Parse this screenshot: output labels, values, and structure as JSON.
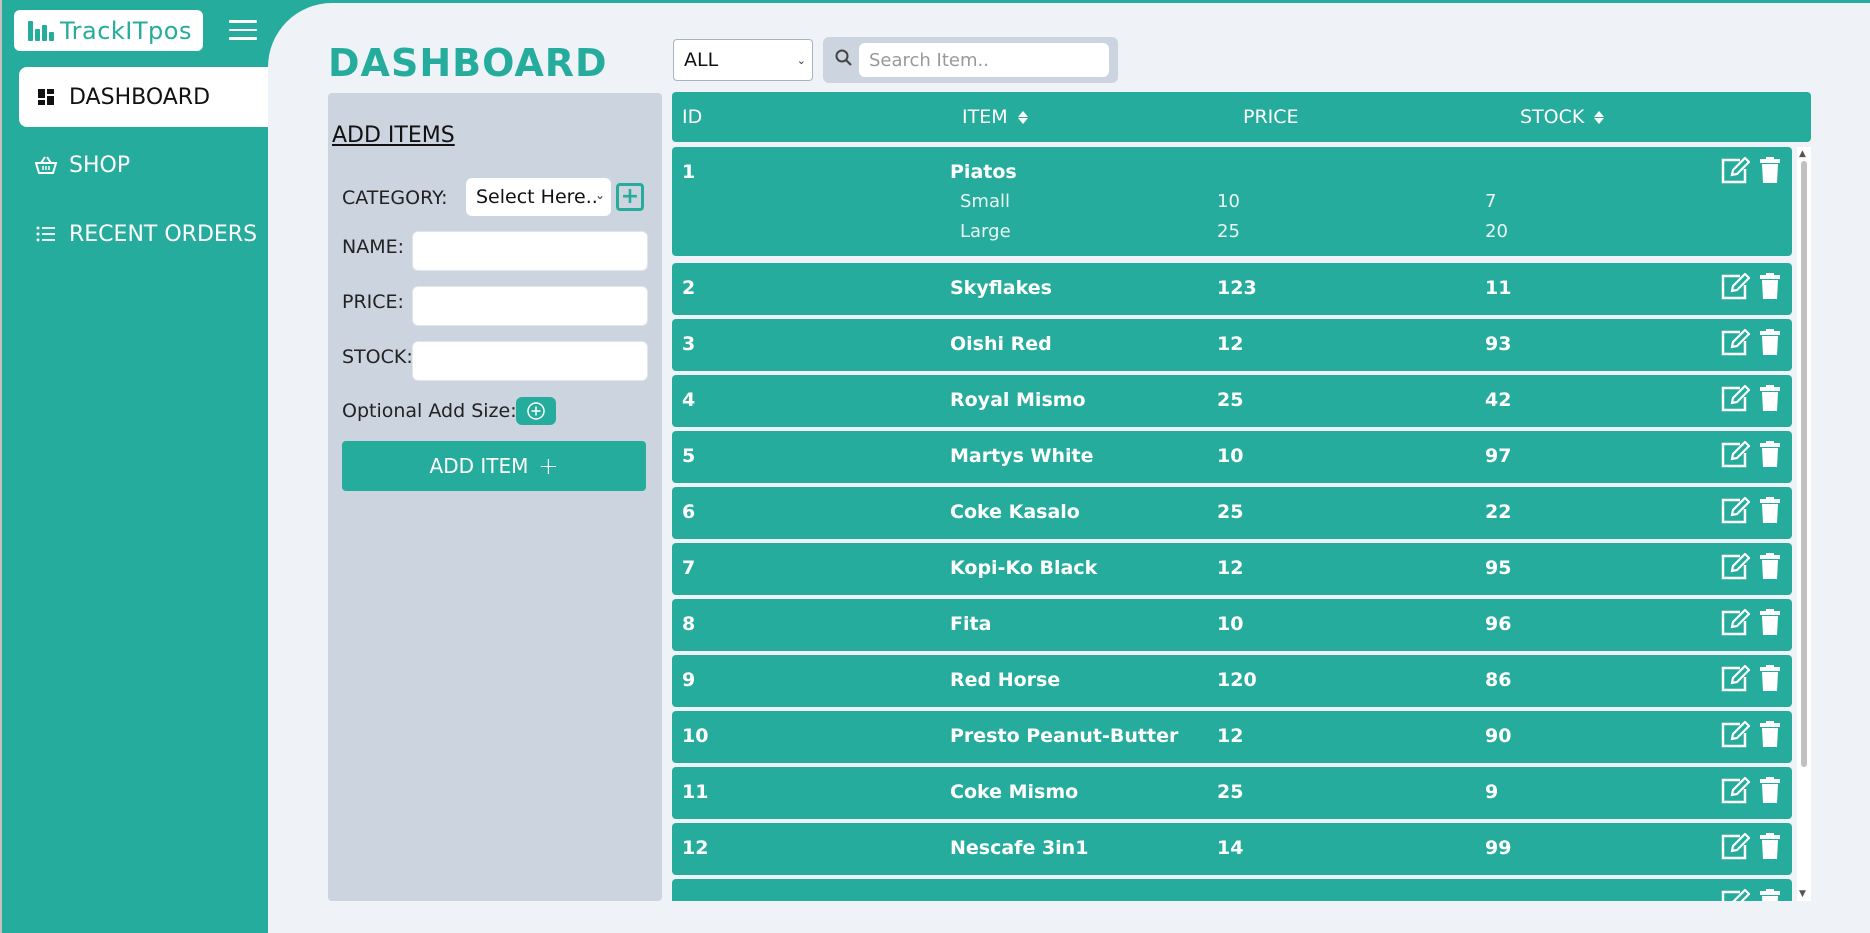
{
  "app": {
    "name": "TrackITpos"
  },
  "sidebar": {
    "items": [
      {
        "label": "DASHBOARD",
        "icon": "dashboard-icon",
        "active": true
      },
      {
        "label": "SHOP",
        "icon": "basket-icon",
        "active": false
      },
      {
        "label": "RECENT ORDERS",
        "icon": "list-icon",
        "active": false
      }
    ]
  },
  "page": {
    "title": "DASHBOARD"
  },
  "filter": {
    "category_value": "ALL",
    "search_placeholder": "Search Item.."
  },
  "add_panel": {
    "title": "ADD ITEMS",
    "category_label": "CATEGORY:",
    "category_placeholder": "Select Here..",
    "name_label": "NAME:",
    "price_label": "PRICE:",
    "stock_label": "STOCK:",
    "optional_size_label": "Optional Add Size:",
    "add_button_label": "ADD ITEM",
    "add_button_symbol": "+"
  },
  "table": {
    "headers": {
      "id": "ID",
      "item": "ITEM",
      "price": "PRICE",
      "stock": "STOCK"
    },
    "rows": [
      {
        "id": "1",
        "item": "Piatos",
        "price": "",
        "stock": "",
        "sizes": [
          {
            "size": "Small",
            "price": "10",
            "stock": "7"
          },
          {
            "size": "Large",
            "price": "25",
            "stock": "20"
          }
        ]
      },
      {
        "id": "2",
        "item": "Skyflakes",
        "price": "123",
        "stock": "11"
      },
      {
        "id": "3",
        "item": "Oishi Red",
        "price": "12",
        "stock": "93"
      },
      {
        "id": "4",
        "item": "Royal Mismo",
        "price": "25",
        "stock": "42"
      },
      {
        "id": "5",
        "item": "Martys White",
        "price": "10",
        "stock": "97"
      },
      {
        "id": "6",
        "item": "Coke Kasalo",
        "price": "25",
        "stock": "22"
      },
      {
        "id": "7",
        "item": "Kopi-Ko Black",
        "price": "12",
        "stock": "95"
      },
      {
        "id": "8",
        "item": "Fita",
        "price": "10",
        "stock": "96"
      },
      {
        "id": "9",
        "item": "Red Horse",
        "price": "120",
        "stock": "86"
      },
      {
        "id": "10",
        "item": "Presto Peanut-Butter",
        "price": "12",
        "stock": "90"
      },
      {
        "id": "11",
        "item": "Coke Mismo",
        "price": "25",
        "stock": "9"
      },
      {
        "id": "12",
        "item": "Nescafe 3in1",
        "price": "14",
        "stock": "99"
      }
    ]
  },
  "colors": {
    "accent": "#26ac9c",
    "background": "#eff2f6",
    "panel": "#ccd4e0"
  }
}
